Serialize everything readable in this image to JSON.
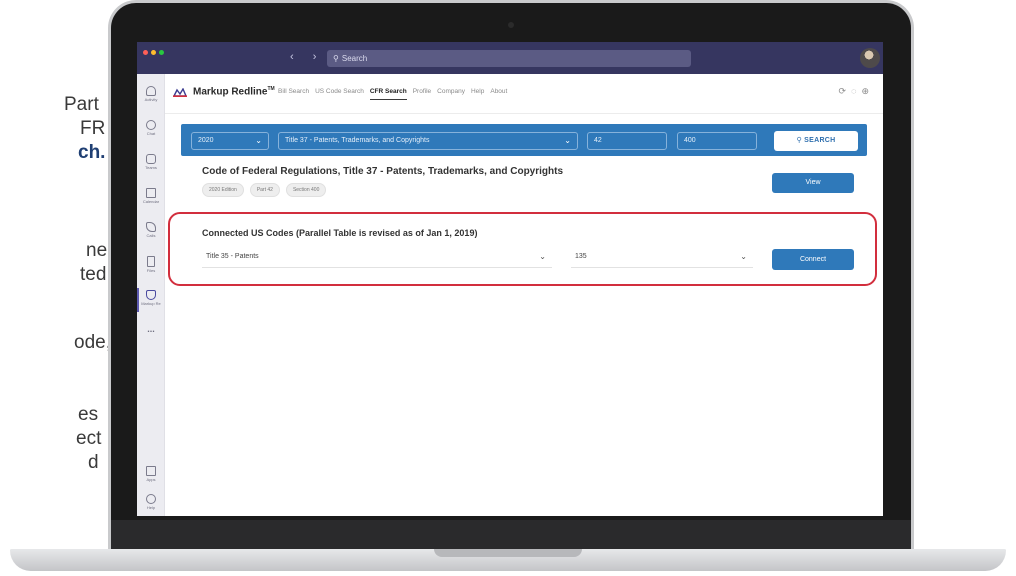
{
  "side_copy": [
    "Part",
    "FR",
    "ch.",
    "ne",
    "ted",
    "ode,",
    "es",
    "ect",
    "d"
  ],
  "topbar": {
    "nav_arrows": "‹ ›",
    "search_placeholder": "Search",
    "traffic_light_colors": [
      "#ff5f57",
      "#febc2e",
      "#28c840"
    ]
  },
  "rail": {
    "items": [
      {
        "label": "Activity",
        "icon": "bell-icon"
      },
      {
        "label": "Chat",
        "icon": "chat-icon"
      },
      {
        "label": "Teams",
        "icon": "teams-icon"
      },
      {
        "label": "Calendar",
        "icon": "calendar-icon"
      },
      {
        "label": "Calls",
        "icon": "phone-icon"
      },
      {
        "label": "Files",
        "icon": "file-icon"
      },
      {
        "label": "Markup Re",
        "icon": "markup-app-icon"
      }
    ],
    "more": "...",
    "bottom": [
      {
        "label": "Apps",
        "icon": "apps-icon"
      },
      {
        "label": "Help",
        "icon": "help-icon"
      }
    ]
  },
  "header": {
    "brand": "Markup Redline",
    "trademark": "TM",
    "menu": [
      "Bill Search",
      "US Code Search",
      "CFR Search",
      "Profile",
      "Company",
      "Help",
      "About"
    ],
    "active_menu": "CFR Search",
    "icons": [
      "refresh-icon",
      "popout-icon",
      "globe-icon"
    ]
  },
  "search_band": {
    "year": "2020",
    "title": "Title 37 - Patents, Trademarks, and Copyrights",
    "part": "42",
    "section": "400",
    "button": "SEARCH",
    "color": "#2f79ba"
  },
  "result": {
    "title": "Code of Federal Regulations, Title 37 - Patents, Trademarks, and Copyrights",
    "tags": [
      "2020 Edition",
      "Part 42",
      "Section 400"
    ],
    "view_button": "View"
  },
  "connected": {
    "title": "Connected US Codes (Parallel Table is revised as of Jan 1, 2019)",
    "title_select": "Title 35 - Patents",
    "section_select": "135",
    "connect_button": "Connect",
    "highlight_color": "#d22e3d"
  }
}
